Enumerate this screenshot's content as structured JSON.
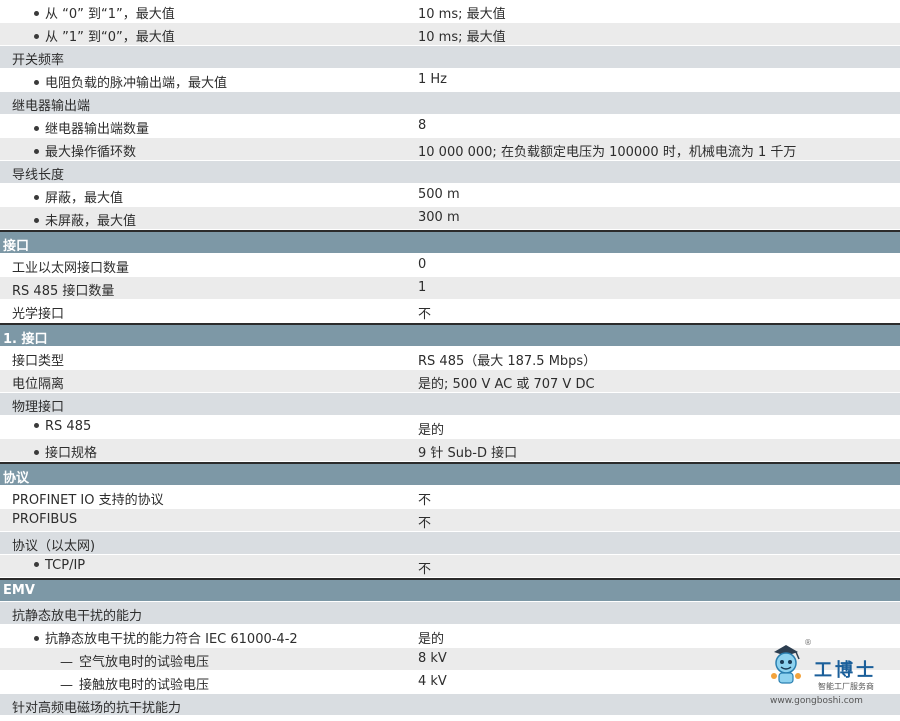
{
  "rows": [
    {
      "l": "从 “0” 到“1”，最大值",
      "v": "10 ms; 最大值"
    },
    {
      "l": "从 ”1” 到“0”，最大值",
      "v": "10 ms; 最大值"
    },
    {
      "l": "开关频率"
    },
    {
      "l": "电阻负载的脉冲输出端，最大值",
      "v": "1 Hz"
    },
    {
      "l": "继电器输出端"
    },
    {
      "l": "继电器输出端数量",
      "v": "8"
    },
    {
      "l": "最大操作循环数",
      "v": "10 000 000; 在负载额定电压为 100000 时，机械电流为 1 千万"
    },
    {
      "l": "导线长度"
    },
    {
      "l": "屏蔽，最大值",
      "v": "500 m"
    },
    {
      "l": "未屏蔽，最大值",
      "v": "300 m"
    },
    {
      "l": "接口"
    },
    {
      "l": "工业以太网接口数量",
      "v": "0"
    },
    {
      "l": "RS 485 接口数量",
      "v": "1"
    },
    {
      "l": "光学接口",
      "v": "不"
    },
    {
      "l": "1. 接口"
    },
    {
      "l": "接口类型",
      "v": "RS 485（最大 187.5 Mbps）"
    },
    {
      "l": "电位隔离",
      "v": "是的; 500 V AC 或 707 V DC"
    },
    {
      "l": "物理接口"
    },
    {
      "l": "RS 485",
      "v": "是的"
    },
    {
      "l": "接口规格",
      "v": "9 针 Sub-D 接口"
    },
    {
      "l": "协议"
    },
    {
      "l": "PROFINET IO 支持的协议",
      "v": "不"
    },
    {
      "l": "PROFIBUS",
      "v": "不"
    },
    {
      "l": "协议（以太网)"
    },
    {
      "l": "TCP/IP",
      "v": "不"
    },
    {
      "l": "EMV"
    },
    {
      "l": "抗静态放电干扰的能力"
    },
    {
      "l": "抗静态放电干扰的能力符合 IEC 61000-4-2",
      "v": "是的"
    },
    {
      "l": "空气放电时的试验电压",
      "v": "8 kV"
    },
    {
      "l": "接触放电时的试验电压",
      "v": "4 kV"
    },
    {
      "l": "针对高频电磁场的抗干扰能力"
    }
  ],
  "watermark": {
    "brand": "工博士",
    "tagline": "智能工厂服务商",
    "url": "www.gongboshi.com",
    "reg": "®"
  }
}
